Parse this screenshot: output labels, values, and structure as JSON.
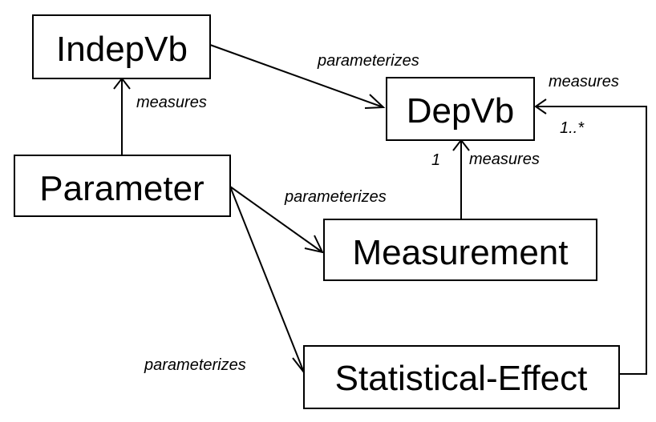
{
  "nodes": {
    "indepvb": "IndepVb",
    "depvb": "DepVb",
    "parameter": "Parameter",
    "measurement": "Measurement",
    "statistical_effect": "Statistical-Effect"
  },
  "edges": {
    "indepvb_to_depvb": "parameterizes",
    "parameter_to_indepvb": "measures",
    "parameter_to_measurement": "parameterizes",
    "parameter_to_statistical_effect": "parameterizes",
    "measurement_to_depvb": "measures",
    "measurement_to_depvb_multiplicity": "1",
    "statistical_effect_to_depvb": "measures",
    "statistical_effect_to_depvb_multiplicity": "1..*"
  }
}
